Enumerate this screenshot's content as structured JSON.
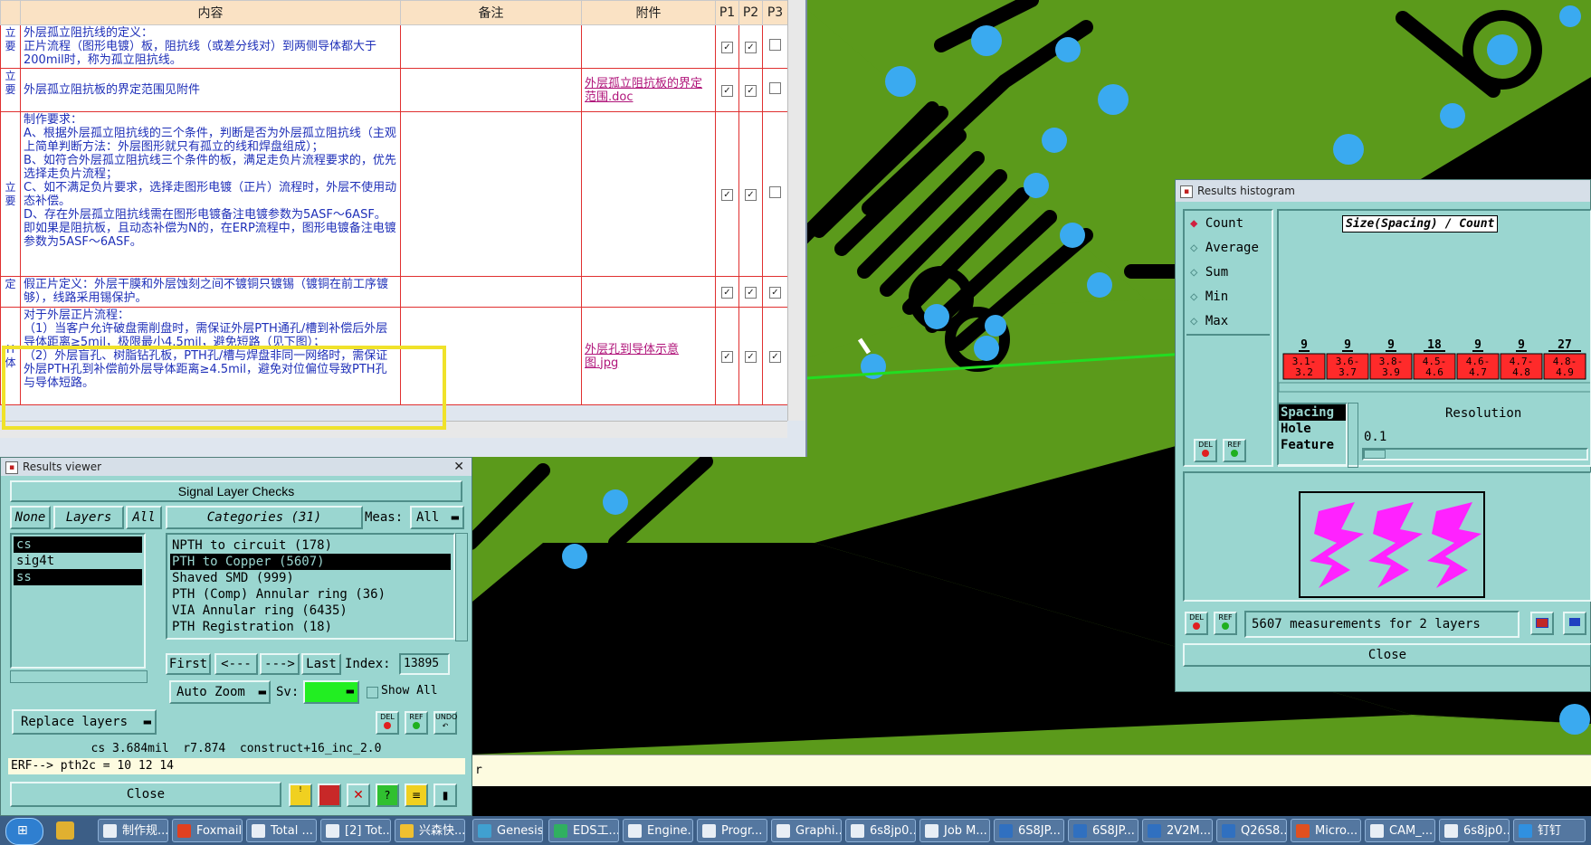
{
  "spreadsheet": {
    "headers": [
      "内容",
      "备注",
      "附件",
      "P1",
      "P2",
      "P3"
    ],
    "rows": [
      {
        "left": "立\n要",
        "content": "外层孤立阻抗线的定义：\n正片流程（图形电镀）板，阻抗线（或差分线对）到两侧导体都大于200mil时，称为孤立阻抗线。",
        "attach": "",
        "p": [
          true,
          true,
          false
        ]
      },
      {
        "left": "立\n要",
        "content": "外层孤立阻抗板的界定范围见附件",
        "attach": "外层孤立阻抗板的界定范围.doc",
        "p": [
          true,
          true,
          false
        ]
      },
      {
        "left": "立\n要",
        "content": "制作要求：\nA、根据外层孤立阻抗线的三个条件，判断是否为外层孤立阻抗线（主观上简单判断方法：外层图形就只有孤立的线和焊盘组成）；\nB、如符合外层孤立阻抗线三个条件的板，满足走负片流程要求的，优先选择走负片流程；\nC、如不满足负片要求，选择走图形电镀（正片）流程时，外层不使用动态补偿。\nD、存在外层孤立阻抗线需在图形电镀备注电镀参数为5ASF～6ASF。\n即如果是阻抗板，且动态补偿为N的，在ERP流程中，图形电镀备注电镀参数为5ASF～6ASF。",
        "attach": "",
        "p": [
          true,
          true,
          false
        ]
      },
      {
        "left": "定",
        "content": "假正片定义：外层干膜和外层蚀刻之间不镀铜只镀锡（镀铜在前工序镀够），线路采用锡保护。",
        "attach": "",
        "p": [
          true,
          true,
          true
        ]
      },
      {
        "left": "H\n体",
        "content": "对于外层正片流程：\n（1）当客户允许破盘需削盘时，需保证外层PTH通孔/槽到补偿后外层导体距离≥5mil，极限最小4.5mil，避免短路（见下图）；\n（2）外层盲孔、树脂钻孔板，PTH孔/槽与焊盘非同一网络时，需保证外层PTH孔到补偿前外层导体距离≥4.5mil，避免对位偏位导致PTH孔与导体短路。",
        "attach": "外层孔到导体示意图.jpg",
        "p": [
          true,
          true,
          true
        ]
      }
    ]
  },
  "results_viewer": {
    "title": "Results viewer",
    "header": "Signal Layer Checks",
    "none_btn": "None",
    "layers_btn": "Layers",
    "all_btn": "All",
    "categories_btn": "Categories (31)",
    "meas_label": "Meas:",
    "meas_value": "All",
    "layers": [
      {
        "name": "cs",
        "selected": true
      },
      {
        "name": "sig4t",
        "selected": false
      },
      {
        "name": "ss",
        "selected": true
      }
    ],
    "categories": [
      {
        "name": "NPTH to circuit (178)",
        "selected": false
      },
      {
        "name": "PTH to Copper (5607)",
        "selected": true
      },
      {
        "name": "Shaved SMD (999)",
        "selected": false
      },
      {
        "name": "PTH (Comp) Annular ring (36)",
        "selected": false
      },
      {
        "name": "VIA Annular ring (6435)",
        "selected": false
      },
      {
        "name": "PTH Registration (18)",
        "selected": false
      }
    ],
    "nav": {
      "first": "First",
      "prev": "<---",
      "next": "--->",
      "last": "Last",
      "index_label": "Index:",
      "index_value": "13895"
    },
    "auto_zoom": "Auto Zoom",
    "sv_label": "Sv:",
    "show_all": "Show All",
    "replace_layers": "Replace layers",
    "del": "DEL",
    "ref": "REF",
    "undo": "UNDO",
    "status": "cs 3.684mil  r7.874  construct+16_inc_2.0",
    "erf_line": "ERF--> pth2c = 10 12 14",
    "close": "Close"
  },
  "histogram": {
    "title": "Results histogram",
    "options": [
      {
        "label": "Count",
        "active": true
      },
      {
        "label": "Average",
        "active": false
      },
      {
        "label": "Sum",
        "active": false
      },
      {
        "label": "Min",
        "active": false
      },
      {
        "label": "Max",
        "active": false
      }
    ],
    "chart_title": "Size(Spacing) / Count",
    "chart_data": {
      "type": "bar",
      "categories": [
        "3.1-3.2",
        "3.6-3.7",
        "3.8-3.9",
        "4.5-4.6",
        "4.6-4.7",
        "4.7-4.8",
        "4.8-4.9"
      ],
      "bin_labels": [
        {
          "top": "3.1-",
          "bottom": "3.2"
        },
        {
          "top": "3.6-",
          "bottom": "3.7"
        },
        {
          "top": "3.8-",
          "bottom": "3.9"
        },
        {
          "top": "4.5-",
          "bottom": "4.6"
        },
        {
          "top": "4.6-",
          "bottom": "4.7"
        },
        {
          "top": "4.7-",
          "bottom": "4.8"
        },
        {
          "top": "4.8-",
          "bottom": "4.9"
        }
      ],
      "values": [
        9,
        9,
        9,
        18,
        9,
        9,
        27
      ],
      "title": "Size(Spacing) / Count"
    },
    "size_types": [
      {
        "label": "Spacing",
        "selected": true
      },
      {
        "label": "Hole",
        "selected": false
      },
      {
        "label": "Feature",
        "selected": false
      }
    ],
    "resolution_label": "Resolution",
    "resolution_value": "0.1",
    "measurements_text": "5607 measurements for 2 layers",
    "del": "DEL",
    "ref": "REF",
    "close": "Close"
  },
  "console_char": "r",
  "taskbar": {
    "items": [
      "制作规...",
      "Foxmail",
      "Total ...",
      "[2] Tot...",
      "兴森快...",
      "Genesis",
      "EDS工...",
      "Engine...",
      "Progr...",
      "Graphi...",
      "6s8jp0...",
      "Job M...",
      "6S8JP...",
      "6S8JP...",
      "2V2M...",
      "Q26S8...",
      "Micro...",
      "CAM_...",
      "6s8jp0...",
      "钉钉"
    ]
  },
  "colors": {
    "pcb_green": "#5b9a1b",
    "pad_blue": "#3aaaf0",
    "panel_teal": "#9ad6d0",
    "bar_red": "#ff2a2a",
    "arrow_green": "#22dd22",
    "highlight_yellow": "#f0e22a"
  }
}
